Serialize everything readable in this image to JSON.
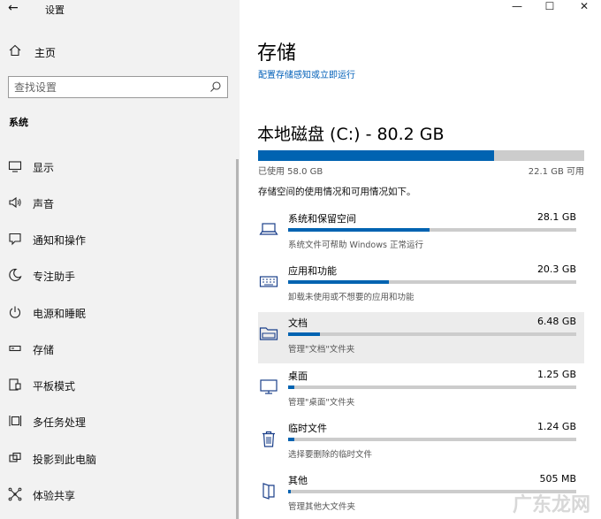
{
  "window": {
    "back_glyph": "←",
    "title": "设置",
    "minimize_glyph": "—",
    "maximize_glyph": "☐",
    "close_glyph": "✕"
  },
  "sidebar": {
    "home_label": "主页",
    "search_placeholder": "查找设置",
    "section_label": "系统",
    "items": [
      {
        "label": "显示",
        "icon": "monitor-icon"
      },
      {
        "label": "声音",
        "icon": "speaker-icon"
      },
      {
        "label": "通知和操作",
        "icon": "notification-icon"
      },
      {
        "label": "专注助手",
        "icon": "moon-icon"
      },
      {
        "label": "电源和睡眠",
        "icon": "power-icon"
      },
      {
        "label": "存储",
        "icon": "storage-icon"
      },
      {
        "label": "平板模式",
        "icon": "tablet-icon"
      },
      {
        "label": "多任务处理",
        "icon": "multitask-icon"
      },
      {
        "label": "投影到此电脑",
        "icon": "project-icon"
      },
      {
        "label": "体验共享",
        "icon": "share-icon"
      }
    ]
  },
  "main": {
    "title": "存储",
    "link": "配置存储感知或立即运行",
    "disk": {
      "name": "本地磁盘 (C:) - 80.2 GB",
      "used_label": "已使用 58.0 GB",
      "available_label": "22.1 GB 可用",
      "used_fraction": 0.724
    },
    "description": "存储空间的使用情况和可用情况如下。",
    "categories": [
      {
        "name": "系统和保留空间",
        "size": "28.1 GB",
        "sub": "系统文件可帮助 Windows 正常运行",
        "fraction": 0.49,
        "icon": "laptop-icon"
      },
      {
        "name": "应用和功能",
        "size": "20.3 GB",
        "sub": "卸载未使用或不想要的应用和功能",
        "fraction": 0.35,
        "icon": "keyboard-icon"
      },
      {
        "name": "文档",
        "size": "6.48 GB",
        "sub": "管理\"文档\"文件夹",
        "fraction": 0.11,
        "icon": "folder-icon"
      },
      {
        "name": "桌面",
        "size": "1.25 GB",
        "sub": "管理\"桌面\"文件夹",
        "fraction": 0.022,
        "icon": "desktop-icon"
      },
      {
        "name": "临时文件",
        "size": "1.24 GB",
        "sub": "选择要删除的临时文件",
        "fraction": 0.022,
        "icon": "trash-icon"
      },
      {
        "name": "其他",
        "size": "505 MB",
        "sub": "管理其他大文件夹",
        "fraction": 0.01,
        "icon": "other-icon"
      }
    ]
  },
  "watermark": "广东龙网",
  "colors": {
    "accent": "#0063b1",
    "link": "#005fb8",
    "sidebar_bg": "#f2f2f2",
    "track": "#cccccc"
  }
}
